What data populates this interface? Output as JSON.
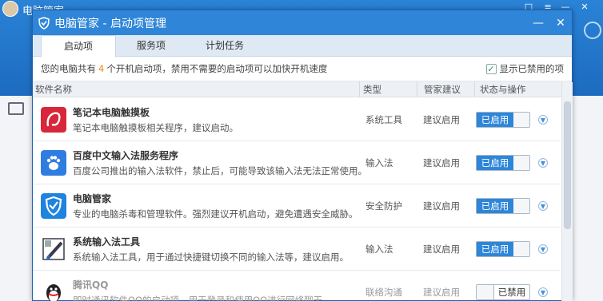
{
  "background": {
    "title": "电脑管家"
  },
  "dialog": {
    "title": "电脑管家 - 启动项管理",
    "tabs": [
      "启动项",
      "服务项",
      "计划任务"
    ],
    "info": {
      "prefix": "您的电脑共有",
      "count": "4",
      "suffix": "个开机启动项，禁用不需要的启动项可以加快开机速度"
    },
    "show_disabled_label": "显示已禁用的项",
    "columns": {
      "name": "软件名称",
      "type": "类型",
      "advice": "管家建议",
      "op": "状态与操作"
    },
    "rows": [
      {
        "name": "笔记本电脑触摸板",
        "desc": "笔记本电脑触摸板相关程序，建议启动。",
        "type": "系统工具",
        "advice": "建议启用",
        "state": "已启用",
        "icon": "touchpad-app-icon",
        "color": "#d8263a",
        "enabled": true
      },
      {
        "name": "百度中文输入法服务程序",
        "desc": "百度公司推出的输入法软件，禁止后，可能导致该输入法无法正常使用。",
        "type": "输入法",
        "advice": "建议启用",
        "state": "已启用",
        "icon": "baidu-input-icon",
        "color": "#2f7de0",
        "enabled": true
      },
      {
        "name": "电脑管家",
        "desc": "专业的电脑杀毒和管理软件。强烈建议开机启动，避免遭遇安全威胁。",
        "type": "安全防护",
        "advice": "建议启用",
        "state": "已启用",
        "icon": "pcmgr-shield-icon",
        "color": "#1f83e0",
        "enabled": true
      },
      {
        "name": "系统输入法工具",
        "desc": "系统输入法工具，用于通过快捷键切换不同的输入法等，建议启用。",
        "type": "输入法",
        "advice": "建议启用",
        "state": "已启用",
        "icon": "input-tool-icon",
        "color": "#3a3a4a",
        "enabled": true
      },
      {
        "name": "腾讯QQ",
        "desc": "即时通讯软件QQ的启动项，用于登录和使用QQ进行网络聊天。",
        "type": "联络沟通",
        "advice": "建议启用",
        "state": "已禁用",
        "icon": "qq-penguin-icon",
        "color": "#222222",
        "enabled": false
      }
    ]
  }
}
